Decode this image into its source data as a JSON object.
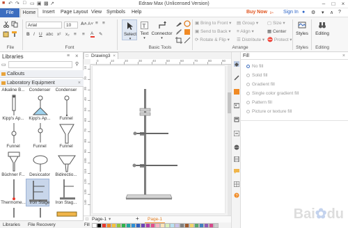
{
  "title": "Edraw Max (Unlicensed Version)",
  "menu": {
    "file": "File",
    "home": "Home",
    "insert": "Insert",
    "page_layout": "Page Layout",
    "view": "View",
    "symbols": "Symbols",
    "help": "Help",
    "buy_now": "Buy Now",
    "sign_in": "Sign In"
  },
  "ribbon": {
    "font_name": "Arial",
    "font_size": "10",
    "groups": {
      "file": "File",
      "font": "Font",
      "basic_tools": "Basic Tools",
      "arrange": "Arrange",
      "styles": "Styles",
      "editing": "Editing"
    },
    "tools": {
      "select": "Select",
      "text": "Text",
      "connector": "Connector"
    },
    "arrange": {
      "bring_to_front": "Bring to Front",
      "send_to_back": "Send to Back",
      "rotate_flip": "Rotate & Flip",
      "group": "Group",
      "align": "Align",
      "distribute": "Distribute",
      "size": "Size",
      "center": "Center",
      "protect": "Protect"
    },
    "styles_label": "Styles",
    "editing_label": "Editing"
  },
  "libraries": {
    "title": "Libraries",
    "search_placeholder": "",
    "sections": [
      "Callouts",
      "Laboratory Equipment"
    ],
    "symbols": [
      [
        "Alkaline B...",
        "Condenser",
        "Condenser"
      ],
      [
        "Kipp's Ap...",
        "Kipp's Ap...",
        "Funnel"
      ],
      [
        "Funnel",
        "Funnel",
        "Funnel"
      ],
      [
        "Büchner F...",
        "Desiccator",
        "Bidirectio..."
      ],
      [
        "Thermome...",
        "Iron Stage",
        "Iron Stag..."
      ]
    ],
    "bottom_tabs": [
      "Libraries",
      "File Recovery"
    ]
  },
  "document": {
    "tab": "Drawing3",
    "page_tab": "Page-1",
    "page_current": "Page-1",
    "add_page": "+",
    "ruler_top": [
      "0",
      "10",
      "20",
      "30",
      "40",
      "50",
      "60",
      "70",
      "80",
      "90"
    ],
    "ruler_left": [
      "10",
      "20",
      "30",
      "40",
      "50",
      "60",
      "70",
      "80",
      "90",
      "100",
      "110",
      "120",
      "130",
      "140"
    ]
  },
  "fill": {
    "title": "Fill",
    "options": [
      "No fill",
      "Solid fill",
      "Gradient fill",
      "Single color gradient fill",
      "Pattern fill",
      "Picture or texture fill"
    ]
  },
  "palette_label": "Fill",
  "palette": [
    "#ffffff",
    "#000000",
    "#e8392d",
    "#f08a24",
    "#f6c23c",
    "#8cc63f",
    "#2eb24a",
    "#1fa6a0",
    "#2b8fd6",
    "#2f5fbf",
    "#6b45b8",
    "#b13da6",
    "#e44e8a",
    "#f7b4c2",
    "#fde4b8",
    "#d9efb8",
    "#b8e2f2",
    "#c9c3ea",
    "#808080",
    "#a05a2c",
    "#f3d36a",
    "#58a86a",
    "#3e7fbf",
    "#8b5bb5",
    "#d6488a",
    "#cccccc"
  ],
  "watermark": "Baidu"
}
